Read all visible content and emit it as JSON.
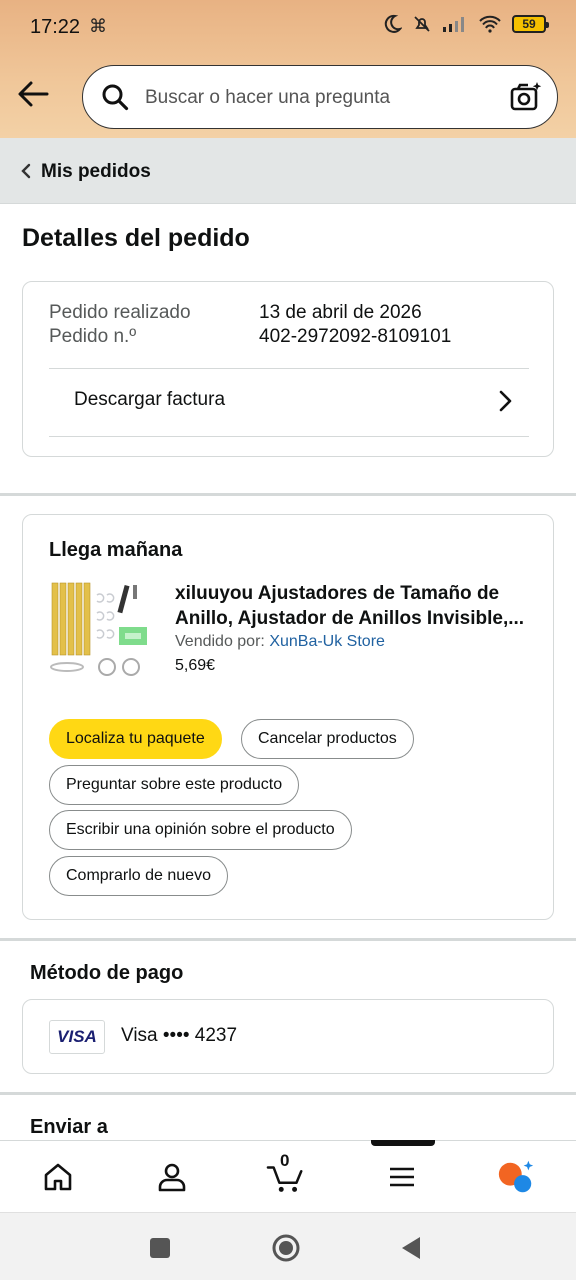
{
  "status_bar": {
    "time": "17:22",
    "battery": "59"
  },
  "search": {
    "placeholder": "Buscar o hacer una pregunta"
  },
  "breadcrumb": {
    "label": "Mis pedidos"
  },
  "page_title": "Detalles del pedido",
  "order_info": {
    "placed_label": "Pedido realizado",
    "placed_value": "13 de abril de 2026",
    "number_label": "Pedido n.º",
    "number_value": "402-2972092-8109101",
    "invoice_label": "Descargar factura"
  },
  "shipment": {
    "arrival": "Llega mañana",
    "product_title_line1": "xiluuyou Ajustadores de Tamaño de",
    "product_title_line2": "Anillo, Ajustador de Anillos Invisible,...",
    "sold_by_label": "Vendido por:",
    "seller": "XunBa-Uk Store",
    "price": "5,69€",
    "actions": {
      "track": "Localiza tu paquete",
      "cancel": "Cancelar productos",
      "ask": "Preguntar sobre este producto",
      "review": "Escribir una opinión sobre el producto",
      "buy_again": "Comprarlo de nuevo"
    }
  },
  "payment": {
    "heading": "Método de pago",
    "card_brand": "VISA",
    "card_text": "Visa •••• 4237"
  },
  "ship_to": {
    "heading": "Enviar a"
  },
  "bottom_nav": {
    "cart_count": "0"
  },
  "colors": {
    "header_orange": "#f0c79a",
    "button_yellow": "#ffd814",
    "link_blue": "#2162a1"
  }
}
